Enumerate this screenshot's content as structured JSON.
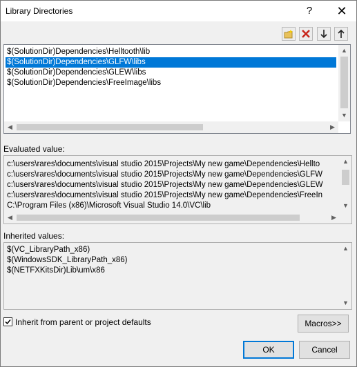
{
  "window": {
    "title": "Library Directories",
    "help_glyph": "?",
    "close_glyph": "✕"
  },
  "toolbar": {
    "new_line_icon": "new-folder-icon",
    "delete_icon": "delete-icon",
    "move_down_icon": "arrow-down-icon",
    "move_up_icon": "arrow-up-icon"
  },
  "directories": [
    "$(SolutionDir)Dependencies\\Helltooth\\lib",
    "$(SolutionDir)Dependencies\\GLFW\\libs",
    "$(SolutionDir)Dependencies\\GLEW\\libs",
    "$(SolutionDir)Dependencies\\FreeImage\\libs"
  ],
  "evaluated": {
    "label": "Evaluated value:",
    "values": [
      "c:\\users\\rares\\documents\\visual studio 2015\\Projects\\My new game\\Dependencies\\Hellto",
      "c:\\users\\rares\\documents\\visual studio 2015\\Projects\\My new game\\Dependencies\\GLFW",
      "c:\\users\\rares\\documents\\visual studio 2015\\Projects\\My new game\\Dependencies\\GLEW",
      "c:\\users\\rares\\documents\\visual studio 2015\\Projects\\My new game\\Dependencies\\FreeIn",
      "C:\\Program Files (x86)\\Microsoft Visual Studio 14.0\\VC\\lib"
    ]
  },
  "inherited": {
    "label": "Inherited values:",
    "values": [
      "$(VC_LibraryPath_x86)",
      "$(WindowsSDK_LibraryPath_x86)",
      "$(NETFXKitsDir)Lib\\um\\x86"
    ]
  },
  "inherit_checkbox": {
    "label": "Inherit from parent or project defaults",
    "checked": true
  },
  "buttons": {
    "macros": "Macros>>",
    "ok": "OK",
    "cancel": "Cancel"
  },
  "colors": {
    "selection": "#0078d7",
    "default_button_border": "#0078d7"
  }
}
